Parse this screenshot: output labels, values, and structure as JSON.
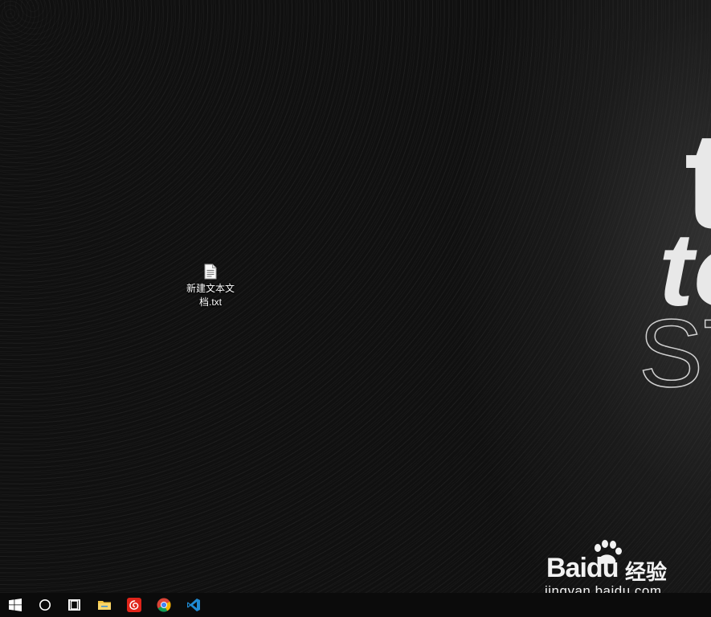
{
  "desktop": {
    "wallpaper": {
      "background_color": "#101010",
      "text_line_1": "t",
      "text_line_2": "to",
      "text_line_3": "ST"
    },
    "icons": [
      {
        "label": "新建文本文档.txt",
        "icon": "text-file-icon"
      }
    ]
  },
  "watermark": {
    "brand": "Bai",
    "brand_suffix": "du",
    "section": "经验",
    "url": "jingyan.baidu.com"
  },
  "taskbar": {
    "background_color": "#0b0b0b",
    "items": [
      {
        "icon": "windows-start-icon"
      },
      {
        "icon": "cortana-search-icon"
      },
      {
        "icon": "task-view-icon"
      },
      {
        "icon": "file-explorer-icon",
        "color": "#f4c542"
      },
      {
        "icon": "netease-music-icon",
        "color": "#e0241a"
      },
      {
        "icon": "chrome-icon"
      },
      {
        "icon": "vscode-icon",
        "color": "#1f8ad2"
      }
    ]
  }
}
